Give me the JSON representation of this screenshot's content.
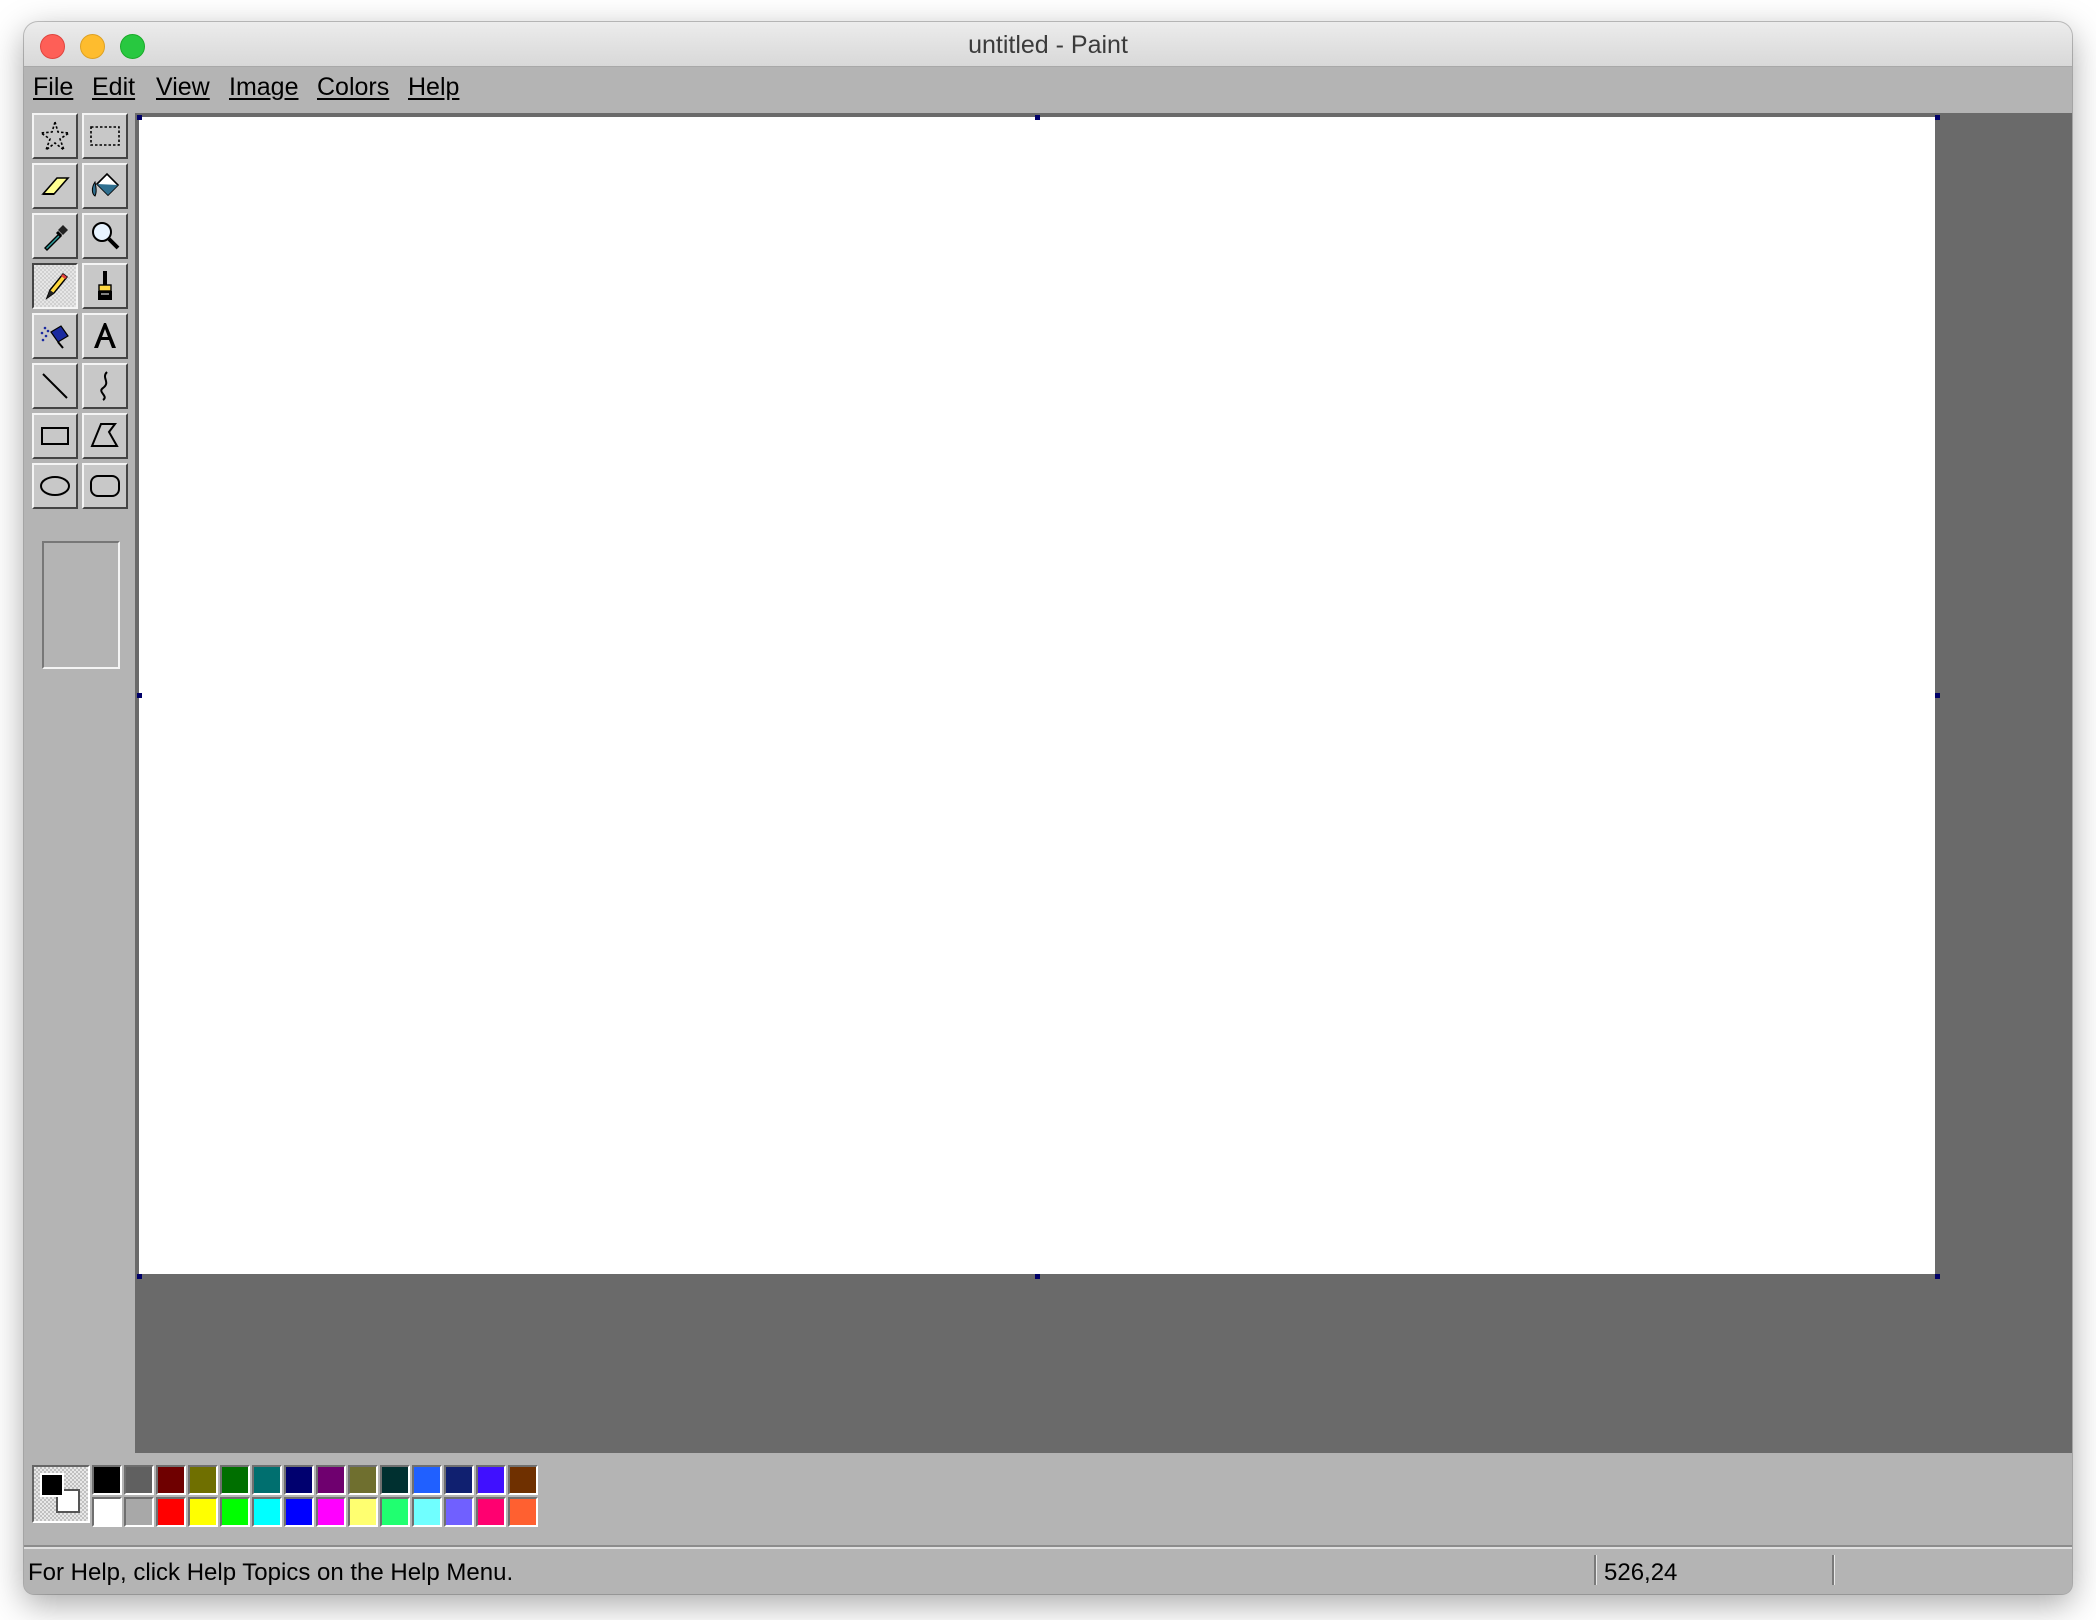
{
  "window": {
    "title": "untitled - Paint"
  },
  "menu": [
    {
      "label": "File"
    },
    {
      "label": "Edit"
    },
    {
      "label": "View"
    },
    {
      "label": "Image"
    },
    {
      "label": "Colors"
    },
    {
      "label": "Help"
    }
  ],
  "tools": [
    {
      "name": "free-form-select",
      "icon": "free-select-icon"
    },
    {
      "name": "select",
      "icon": "rect-select-icon"
    },
    {
      "name": "eraser",
      "icon": "eraser-icon"
    },
    {
      "name": "fill-with-color",
      "icon": "paint-bucket-icon"
    },
    {
      "name": "pick-color",
      "icon": "eyedropper-icon"
    },
    {
      "name": "magnifier",
      "icon": "magnifier-icon"
    },
    {
      "name": "pencil",
      "icon": "pencil-icon",
      "active": true
    },
    {
      "name": "brush",
      "icon": "brush-icon"
    },
    {
      "name": "airbrush",
      "icon": "airbrush-icon"
    },
    {
      "name": "text",
      "icon": "text-icon"
    },
    {
      "name": "line",
      "icon": "line-icon"
    },
    {
      "name": "curve",
      "icon": "curve-icon"
    },
    {
      "name": "rectangle",
      "icon": "rectangle-icon"
    },
    {
      "name": "polygon",
      "icon": "polygon-icon"
    },
    {
      "name": "ellipse",
      "icon": "ellipse-icon"
    },
    {
      "name": "rounded-rectangle",
      "icon": "rounded-rectangle-icon"
    }
  ],
  "colors": {
    "foreground": "#000000",
    "background": "#ffffff",
    "palette_top": [
      "#000000",
      "#606060",
      "#6f0000",
      "#6f6f00",
      "#006f00",
      "#006f6f",
      "#00006f",
      "#6f006f",
      "#6f6f2f",
      "#003030",
      "#2060ff",
      "#102070",
      "#4010ff",
      "#6f3000"
    ],
    "palette_bottom": [
      "#ffffff",
      "#a8a8a8",
      "#ff0000",
      "#ffff00",
      "#00ff00",
      "#00ffff",
      "#0000ff",
      "#ff00ff",
      "#ffff70",
      "#20ff70",
      "#70ffff",
      "#7060ff",
      "#ff0070",
      "#ff6030"
    ]
  },
  "status": {
    "help_text": "For Help, click Help Topics on the Help Menu.",
    "coordinates": "526,24"
  }
}
